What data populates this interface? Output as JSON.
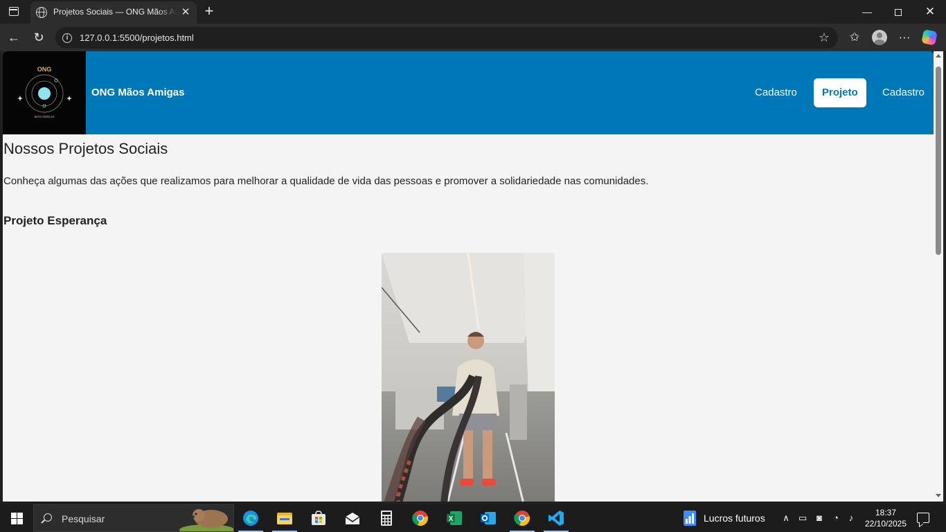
{
  "browser": {
    "tab_title": "Projetos Sociais — ONG Mãos Amigas",
    "url": "127.0.0.1:5500/projetos.html"
  },
  "site": {
    "logo_text": "ONG",
    "logo_subtext": "MÃO AMIGAS",
    "name": "ONG Mãos Amigas",
    "nav": [
      "Cadastro",
      "Projeto",
      "Cadastro"
    ],
    "active_nav_index": 1,
    "brand_color": "#0077b6"
  },
  "page": {
    "title": "Nossos Projetos Sociais",
    "intro": "Conheça algumas das ações que realizamos para melhorar a qualidade de vida das pessoas e promover a solidariedade nas comunidades.",
    "project_title": "Projeto Esperança"
  },
  "taskbar": {
    "search_placeholder": "Pesquisar",
    "news_label": "Lucros futuros",
    "time": "18:37",
    "date": "22/10/2025",
    "apps": [
      "edge-icon",
      "file-explorer-icon",
      "store-icon",
      "mail-icon",
      "calculator-icon",
      "chrome-icon",
      "excel-icon",
      "outlook-icon",
      "chrome-icon",
      "vscode-icon"
    ]
  }
}
